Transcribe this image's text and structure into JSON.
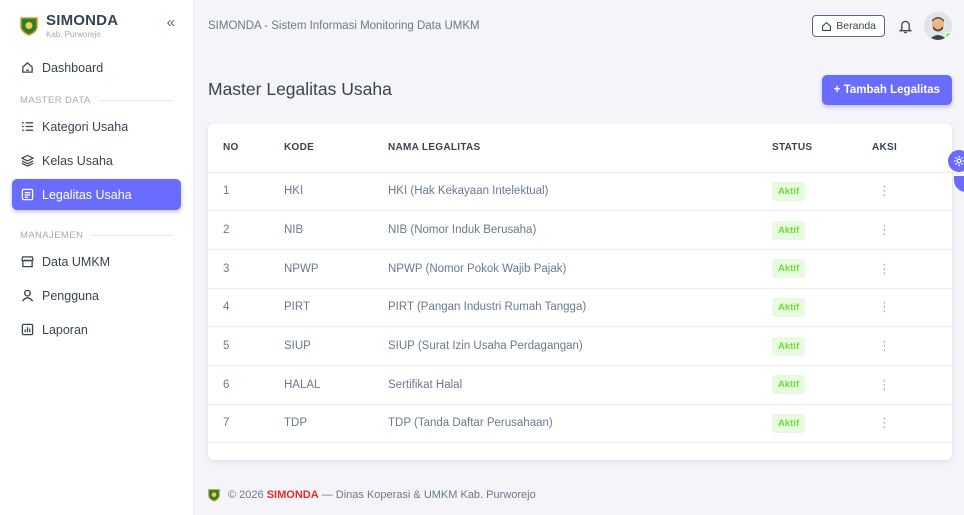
{
  "brand": {
    "name": "SIMONDA",
    "subtitle": "Kab. Purworejo",
    "collapse_icon": "«"
  },
  "sidebar": {
    "dashboard": "Dashboard",
    "master_header": "MASTER DATA",
    "master_items": [
      {
        "label": "Kategori Usaha",
        "icon": "list-icon"
      },
      {
        "label": "Kelas Usaha",
        "icon": "layers-icon"
      },
      {
        "label": "Legalitas Usaha",
        "icon": "document-icon",
        "active": true
      }
    ],
    "manage_header": "MANAJEMEN",
    "manage_items": [
      {
        "label": "Data UMKM",
        "icon": "store-icon"
      },
      {
        "label": "Pengguna",
        "icon": "user-icon"
      },
      {
        "label": "Laporan",
        "icon": "report-icon"
      }
    ]
  },
  "navbar": {
    "title": "SIMONDA - Sistem Informasi Monitoring Data UMKM",
    "beranda_label": "Beranda"
  },
  "page": {
    "title": "Master Legalitas Usaha",
    "add_button": "+ Tambah Legalitas"
  },
  "table": {
    "headers": {
      "no": "NO",
      "kode": "KODE",
      "nama": "NAMA LEGALITAS",
      "status": "STATUS",
      "aksi": "AKSI"
    },
    "rows": [
      {
        "no": "1",
        "kode": "HKI",
        "nama": "HKI (Hak Kekayaan Intelektual)",
        "status": "Aktif"
      },
      {
        "no": "2",
        "kode": "NIB",
        "nama": "NIB (Nomor Induk Berusaha)",
        "status": "Aktif"
      },
      {
        "no": "3",
        "kode": "NPWP",
        "nama": "NPWP (Nomor Pokok Wajib Pajak)",
        "status": "Aktif"
      },
      {
        "no": "4",
        "kode": "PIRT",
        "nama": "PIRT (Pangan Industri Rumah Tangga)",
        "status": "Aktif"
      },
      {
        "no": "5",
        "kode": "SIUP",
        "nama": "SIUP (Surat Izin Usaha Perdagangan)",
        "status": "Aktif"
      },
      {
        "no": "6",
        "kode": "HALAL",
        "nama": "Sertifikat Halal",
        "status": "Aktif"
      },
      {
        "no": "7",
        "kode": "TDP",
        "nama": "TDP (Tanda Daftar Perusahaan)",
        "status": "Aktif"
      }
    ]
  },
  "footer": {
    "prefix": "© 2026",
    "brand": "SIMONDA",
    "suffix": "— Dinas Koperasi & UMKM Kab. Purworejo"
  },
  "colors": {
    "primary": "#696cff",
    "success": "#71dd37",
    "brand_red": "#e02d2d"
  }
}
